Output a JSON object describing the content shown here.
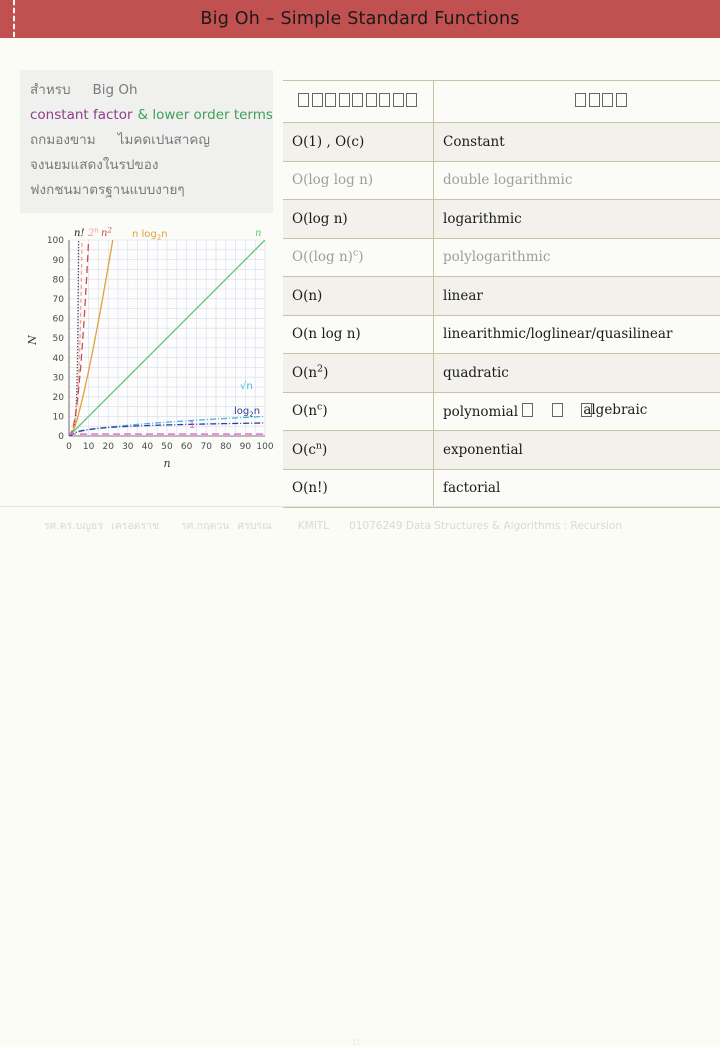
{
  "slide": {
    "title": "Big Oh – Simple Standard Functions",
    "header_color": "#c15050"
  },
  "sidebar": {
    "lines": [
      {
        "id": "l1",
        "parts": [
          {
            "text": "สำหรบ",
            "style": "thai"
          },
          {
            "text": "Big Oh",
            "style": "thai"
          }
        ]
      },
      {
        "id": "l2",
        "parts": [
          {
            "text": "constant factor",
            "style": "purple"
          },
          {
            "text": "& lower order terms",
            "style": "green"
          }
        ]
      },
      {
        "id": "l3",
        "parts": [
          {
            "text": "ถกมองขาม",
            "style": "thai"
          },
          {
            "text": "ไมคดเปนสาคญ",
            "style": "thai"
          }
        ]
      },
      {
        "id": "l4",
        "parts": [
          {
            "text": "จงนยมแสดงในรปของ",
            "style": "thai"
          }
        ]
      },
      {
        "id": "l5",
        "parts": [
          {
            "text": "ฟงกชนมาตรฐานแบบงายๆ",
            "style": "thai"
          }
        ]
      }
    ],
    "line1_a": "สำหรบ",
    "line1_b": "Big Oh",
    "line2_a": "constant factor",
    "line2_b": "& lower order terms",
    "line3_a": "ถกมองขาม",
    "line3_b": "ไมคดเปนสาคญ",
    "line4": "จงนยมแสดงในรปของ",
    "line5": "ฟงกชนมาตรฐานแบบงายๆ"
  },
  "table": {
    "header": {
      "col1_boxes": 9,
      "col2_boxes": 4
    },
    "rows": [
      {
        "notation": "O(1) , O(c)",
        "name": "Constant",
        "faded": false,
        "sup": ""
      },
      {
        "notation": "O(log log n)",
        "name": "double logarithmic",
        "faded": true,
        "sup": ""
      },
      {
        "notation": "O(log n)",
        "name": "logarithmic",
        "faded": false,
        "sup": ""
      },
      {
        "notation": "O((log n)",
        "name": "polylogarithmic",
        "faded": true,
        "sup": "c",
        "tail": ")"
      },
      {
        "notation": "O(n)",
        "name": "linear",
        "faded": false,
        "sup": ""
      },
      {
        "notation": "O(n log n)",
        "name": "linearithmic/loglinear/quasilinear",
        "faded": false,
        "sup": ""
      },
      {
        "notation": "O(n",
        "name": "quadratic",
        "faded": false,
        "sup": "2",
        "tail": ")"
      },
      {
        "notation": "O(n",
        "name": "polynomial",
        "faded": false,
        "sup": "c",
        "tail": ")",
        "name_extra": "algebraic",
        "name_boxes": 3
      },
      {
        "notation": "O(c",
        "name": "exponential",
        "faded": false,
        "sup": "n",
        "tail": ")"
      },
      {
        "notation": "O(n!)",
        "name": "factorial",
        "faded": false,
        "sup": ""
      }
    ]
  },
  "chart_data": {
    "type": "line",
    "title": "",
    "xlabel": "n",
    "ylabel": "N",
    "xlim": [
      0,
      100
    ],
    "ylim": [
      0,
      100
    ],
    "xticks": [
      0,
      10,
      20,
      30,
      40,
      50,
      60,
      70,
      80,
      90,
      100
    ],
    "yticks": [
      0,
      10,
      20,
      30,
      40,
      50,
      60,
      70,
      80,
      90,
      100
    ],
    "grid": true,
    "legend_position": "inline-curve-labels",
    "series": [
      {
        "name": "n!",
        "label": "n!",
        "color": "#1a1a1a",
        "dash": "1,2",
        "curve": "factorial"
      },
      {
        "name": "2^n",
        "label": "2",
        "sup": "n",
        "color": "#f2a29c",
        "dash": "4,3",
        "curve": "exp2"
      },
      {
        "name": "n^2",
        "label": "n",
        "sup": "2",
        "color": "#cf4b52",
        "dash": "7,4",
        "curve": "quad"
      },
      {
        "name": "n log2 n",
        "label": "n log",
        "sub": "2",
        "label2": "n",
        "color": "#e0a23a",
        "dash": "",
        "curve": "nlogn"
      },
      {
        "name": "n",
        "label": "n",
        "color": "#5cc776",
        "dash": "",
        "curve": "linear"
      },
      {
        "name": "sqrt(n)",
        "label": "√n",
        "color": "#49b6d8",
        "dash": "6,2,1,2",
        "curve": "sqrt"
      },
      {
        "name": "log2 n",
        "label": "log",
        "sub": "2",
        "label2": "n",
        "color": "#2a3f9e",
        "dash": "6,2,1,2",
        "curve": "log2"
      },
      {
        "name": "1",
        "label": "1",
        "color": "#e85fd0",
        "dash": "7,4",
        "curve": "const"
      }
    ]
  },
  "footer": {
    "author1": "รศ.ดร.บญธร",
    "author1b": "เครอตราช",
    "author2": "รศ.กฤตวน",
    "author2b": "ศรบรณ",
    "org": "KMITL",
    "course": "01076249 Data Structures & Algorithms : Recursion",
    "page": "11"
  }
}
